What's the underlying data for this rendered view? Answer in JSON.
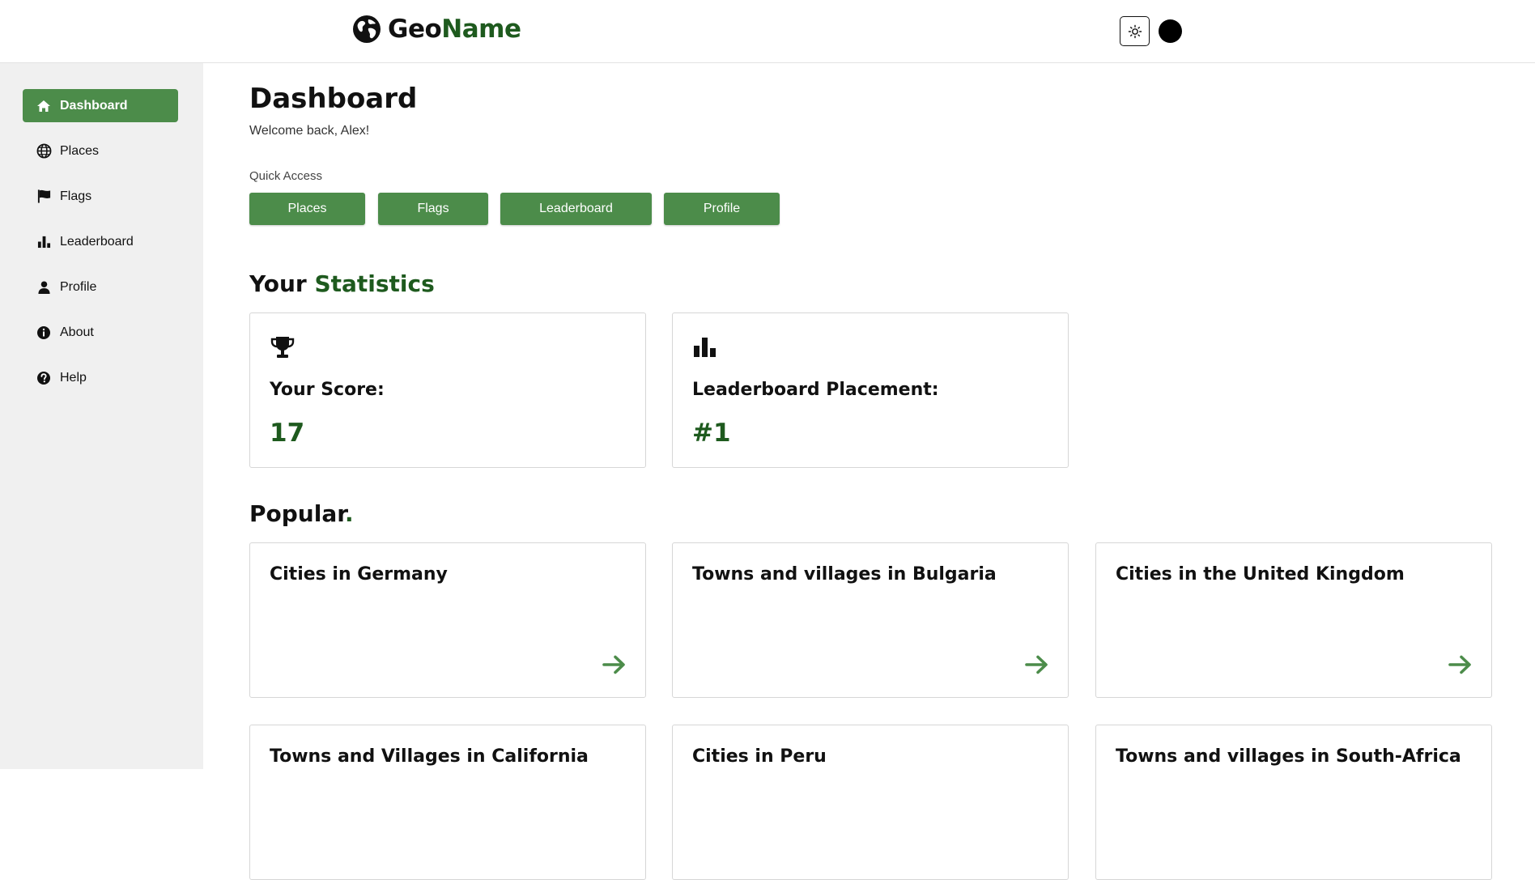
{
  "header": {
    "brand_part1": "Geo",
    "brand_part2": "Name",
    "theme_toggle_icon": "sun-icon",
    "accent_color": "#1e5a1e"
  },
  "sidebar": {
    "items": [
      {
        "label": "Dashboard",
        "icon": "home-icon",
        "active": true
      },
      {
        "label": "Places",
        "icon": "globe-icon"
      },
      {
        "label": "Flags",
        "icon": "flag-icon"
      },
      {
        "label": "Leaderboard",
        "icon": "bar-chart-icon"
      },
      {
        "label": "Profile",
        "icon": "user-icon"
      },
      {
        "label": "About",
        "icon": "info-icon"
      },
      {
        "label": "Help",
        "icon": "help-icon"
      }
    ],
    "active_color": "#4c8c4a"
  },
  "main": {
    "title": "Dashboard",
    "welcome": "Welcome back, Alex!",
    "quick_access": {
      "label": "Quick Access",
      "buttons": [
        "Places",
        "Flags",
        "Leaderboard",
        "Profile"
      ]
    },
    "statistics": {
      "title_part1": "Your",
      "title_part2": "Statistics",
      "cards": [
        {
          "icon": "trophy-icon",
          "label": "Your Score:",
          "value": "17"
        },
        {
          "icon": "bar-chart-icon",
          "label": "Leaderboard Placement:",
          "value": "#1"
        }
      ]
    },
    "popular": {
      "title": "Popular",
      "title_dot": ".",
      "items": [
        "Cities in Germany",
        "Towns and villages in Bulgaria",
        "Cities in the United Kingdom",
        "Towns and Villages in California",
        "Cities in Peru",
        "Towns and villages in South-Africa"
      ]
    }
  }
}
